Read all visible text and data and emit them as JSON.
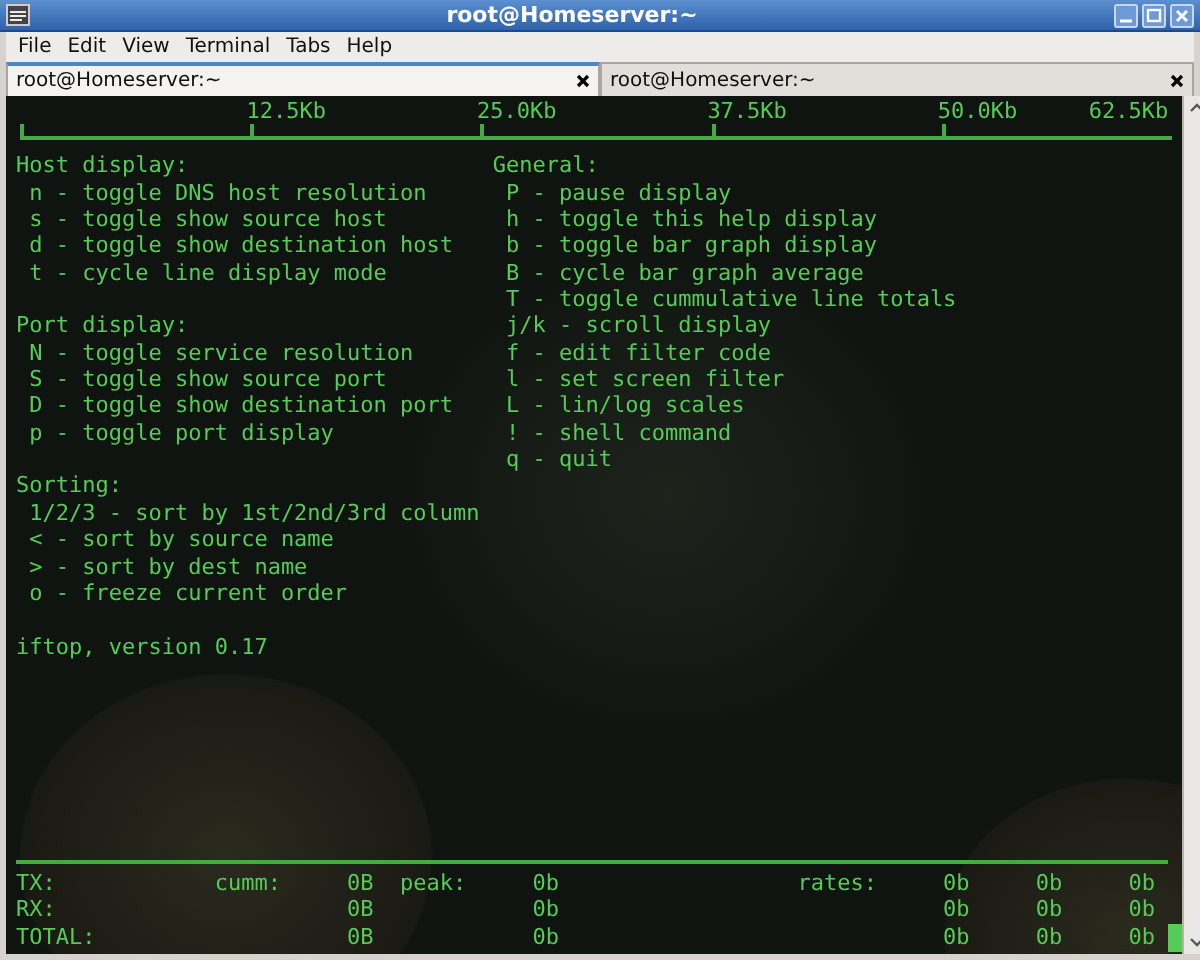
{
  "window": {
    "title": "root@Homeserver:~"
  },
  "menu": [
    "File",
    "Edit",
    "View",
    "Terminal",
    "Tabs",
    "Help"
  ],
  "tabs": [
    {
      "label": "root@Homeserver:~",
      "selected": true
    },
    {
      "label": "root@Homeserver:~",
      "selected": false
    }
  ],
  "terminal": {
    "scale": [
      "12.5Kb",
      "25.0Kb",
      "37.5Kb",
      "50.0Kb",
      "62.5Kb"
    ],
    "help_left": [
      {
        "heading": "Host display:",
        "items": [
          "n - toggle DNS host resolution",
          "s - toggle show source host",
          "d - toggle show destination host",
          "t - cycle line display mode"
        ]
      },
      {
        "heading": "Port display:",
        "items": [
          "N - toggle service resolution",
          "S - toggle show source port",
          "D - toggle show destination port",
          "p - toggle port display"
        ]
      },
      {
        "heading": "Sorting:",
        "items": [
          "1/2/3 - sort by 1st/2nd/3rd column",
          "< - sort by source name",
          "> - sort by dest name",
          "o - freeze current order"
        ]
      }
    ],
    "help_right": [
      {
        "heading": "General:",
        "items": [
          "P - pause display",
          "h - toggle this help display",
          "b - toggle bar graph display",
          "B - cycle bar graph average",
          "T - toggle cummulative line totals",
          "j/k - scroll display",
          "f - edit filter code",
          "l - set screen filter",
          "L - lin/log scales",
          "! - shell command",
          "q - quit"
        ]
      }
    ],
    "version": "iftop, version 0.17",
    "stats": [
      {
        "label": "TX:",
        "cumm_label": "cumm:",
        "cumm": "0B",
        "peak_label": "peak:",
        "peak": "0b",
        "rates_label": "rates:",
        "rates": [
          "0b",
          "0b",
          "0b"
        ]
      },
      {
        "label": "RX:",
        "cumm": "0B",
        "peak": "0b",
        "rates": [
          "0b",
          "0b",
          "0b"
        ]
      },
      {
        "label": "TOTAL:",
        "cumm": "0B",
        "peak": "0b",
        "rates": [
          "0b",
          "0b",
          "0b"
        ]
      }
    ]
  }
}
